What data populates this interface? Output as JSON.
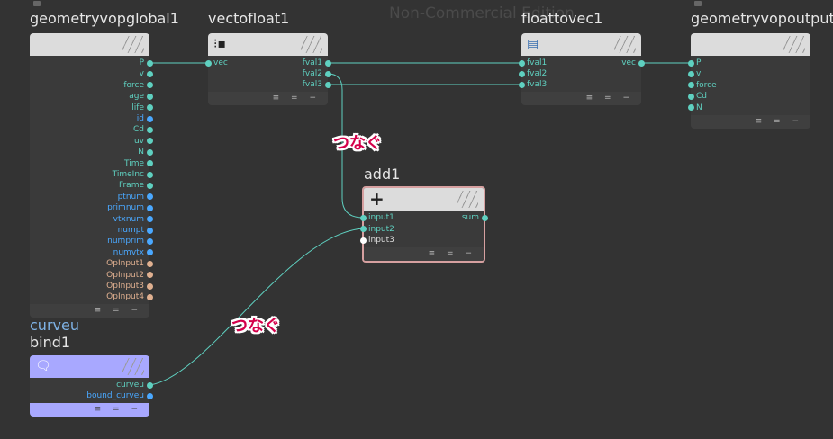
{
  "watermark": "Non-Commercial Edition",
  "colors": {
    "accent": "#5fd0c0",
    "float": "#5fd0c0",
    "int": "#4aa8ff",
    "string": "#e0b090",
    "white": "#ffffff"
  },
  "nodes": {
    "global": {
      "title": "geometryvopglobal1",
      "outputs": [
        "P",
        "v",
        "force",
        "age",
        "life",
        "id",
        "Cd",
        "uv",
        "N",
        "Time",
        "TimeInc",
        "Frame",
        "ptnum",
        "primnum",
        "vtxnum",
        "numpt",
        "numprim",
        "numvtx",
        "OpInput1",
        "OpInput2",
        "OpInput3",
        "OpInput4"
      ]
    },
    "vectofloat": {
      "title": "vectofloat1",
      "input": "vec",
      "outputs": [
        "fval1",
        "fval2",
        "fval3"
      ]
    },
    "floattovec": {
      "title": "floattovec1",
      "inputs": [
        "fval1",
        "fval2",
        "fval3"
      ],
      "output": "vec"
    },
    "output": {
      "title": "geometryvopoutput",
      "inputs": [
        "P",
        "v",
        "force",
        "Cd",
        "N"
      ]
    },
    "add": {
      "title": "add1",
      "inputs": [
        "input1",
        "input2",
        "input3"
      ],
      "output": "sum"
    },
    "bind": {
      "label": "curveu",
      "title": "bind1",
      "outputs": [
        "curveu",
        "bound_curveu"
      ]
    }
  },
  "footer_glyphs": "≡ = −",
  "annotations": [
    "つなぐ",
    "つなぐ"
  ]
}
